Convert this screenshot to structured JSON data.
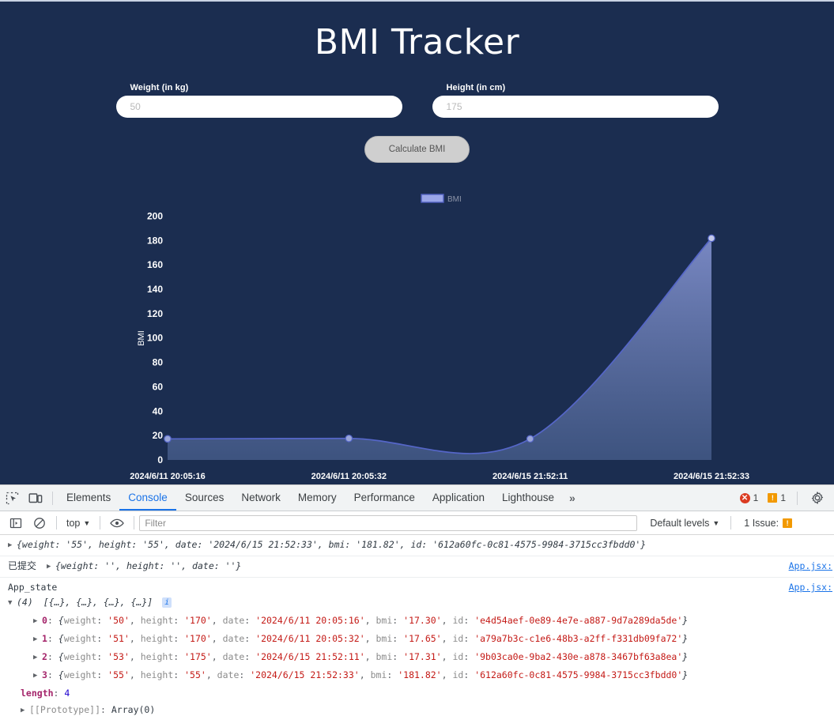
{
  "app": {
    "title": "BMI Tracker",
    "weight_field": {
      "label": "Weight (in kg)",
      "placeholder": "50",
      "value": ""
    },
    "height_field": {
      "label": "Height (in cm)",
      "placeholder": "175",
      "value": ""
    },
    "calculate_button": "Calculate BMI",
    "bg_color": "#1b2d50",
    "accent_color": "#6b7fc4"
  },
  "chart_data": {
    "type": "area",
    "title": "",
    "xlabel": "",
    "ylabel": "BMI",
    "legend": [
      "BMI"
    ],
    "legend_position": "top-center",
    "grid": false,
    "ylim": [
      0,
      210
    ],
    "yticks": [
      0,
      20,
      40,
      60,
      80,
      100,
      120,
      140,
      160,
      180,
      200
    ],
    "categories": [
      "2024/6/11 20:05:16",
      "2024/6/11 20:05:32",
      "2024/6/15 21:52:11",
      "2024/6/15 21:52:33"
    ],
    "series": [
      {
        "name": "BMI",
        "values": [
          17.3,
          17.65,
          17.31,
          181.82
        ]
      }
    ]
  },
  "devtools": {
    "tabs": [
      {
        "label": "Elements",
        "active": false
      },
      {
        "label": "Console",
        "active": true
      },
      {
        "label": "Sources",
        "active": false
      },
      {
        "label": "Network",
        "active": false
      },
      {
        "label": "Memory",
        "active": false
      },
      {
        "label": "Performance",
        "active": false
      },
      {
        "label": "Application",
        "active": false
      },
      {
        "label": "Lighthouse",
        "active": false
      }
    ],
    "more_tabs": "»",
    "error_count": "1",
    "warning_count": "1",
    "context": "top",
    "filter_placeholder": "Filter",
    "levels": "Default levels",
    "issues_label": "1 Issue:"
  },
  "console": {
    "rows": [
      {
        "kind": "object-preview",
        "prefix": "",
        "text": "{weight: '55', height: '55', date: '2024/6/15 21:52:33', bmi: '181.82', id: '612a60fc-0c81-4575-9984-3715cc3fbdd0'}",
        "source": ""
      },
      {
        "kind": "labeled-object",
        "label": "已提交",
        "text": "{weight: '', height: '', date: ''}",
        "source": "App.jsx:"
      },
      {
        "kind": "label-only",
        "text": "App_state",
        "source": "App.jsx:"
      }
    ],
    "array": {
      "count_label": "(4)",
      "preview": "[{…}, {…}, {…}, {…}]",
      "info_badge": "i",
      "items": [
        {
          "index": "0",
          "weight": "50",
          "height": "170",
          "date": "2024/6/11 20:05:16",
          "bmi": "17.30",
          "id": "e4d54aef-0e89-4e7e-a887-9d7a289da5de"
        },
        {
          "index": "1",
          "weight": "51",
          "height": "170",
          "date": "2024/6/11 20:05:32",
          "bmi": "17.65",
          "id": "a79a7b3c-c1e6-48b3-a2ff-f331db09fa72"
        },
        {
          "index": "2",
          "weight": "53",
          "height": "175",
          "date": "2024/6/15 21:52:11",
          "bmi": "17.31",
          "id": "9b03ca0e-9ba2-430e-a878-3467bf63a8ea"
        },
        {
          "index": "3",
          "weight": "55",
          "height": "55",
          "date": "2024/6/15 21:52:33",
          "bmi": "181.82",
          "id": "612a60fc-0c81-4575-9984-3715cc3fbdd0"
        }
      ],
      "length_key": "length",
      "length_value": "4",
      "prototype_key": "[[Prototype]]",
      "prototype_value": "Array(0)"
    },
    "keys": {
      "weight": "weight",
      "height": "height",
      "date": "date",
      "bmi": "bmi",
      "id": "id"
    }
  }
}
